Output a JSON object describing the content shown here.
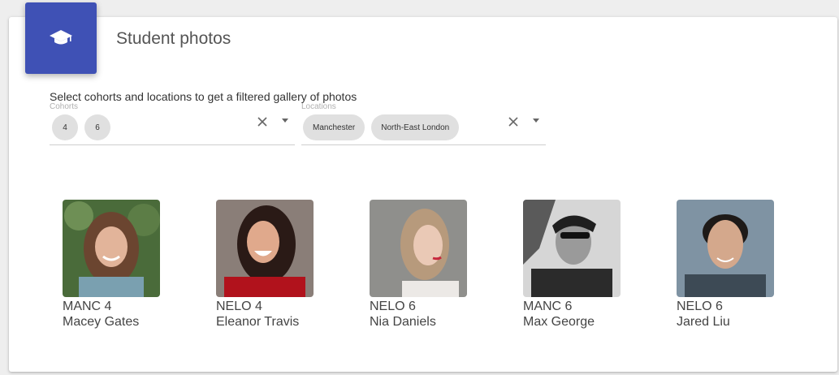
{
  "header": {
    "title": "Student photos",
    "icon": "graduation-cap-icon",
    "accent_color": "#3f51b5"
  },
  "filters": {
    "instructions": "Select cohorts and locations to get a filtered gallery of photos",
    "cohorts": {
      "label": "Cohorts",
      "chips": [
        "4",
        "6"
      ]
    },
    "locations": {
      "label": "Locations",
      "chips": [
        "Manchester",
        "North-East London"
      ]
    }
  },
  "gallery": [
    {
      "cohort": "MANC 4",
      "name": "Macey Gates"
    },
    {
      "cohort": "NELO 4",
      "name": "Eleanor Travis"
    },
    {
      "cohort": "NELO 6",
      "name": "Nia Daniels"
    },
    {
      "cohort": "MANC 6",
      "name": "Max George"
    },
    {
      "cohort": "NELO 6",
      "name": "Jared Liu"
    }
  ]
}
